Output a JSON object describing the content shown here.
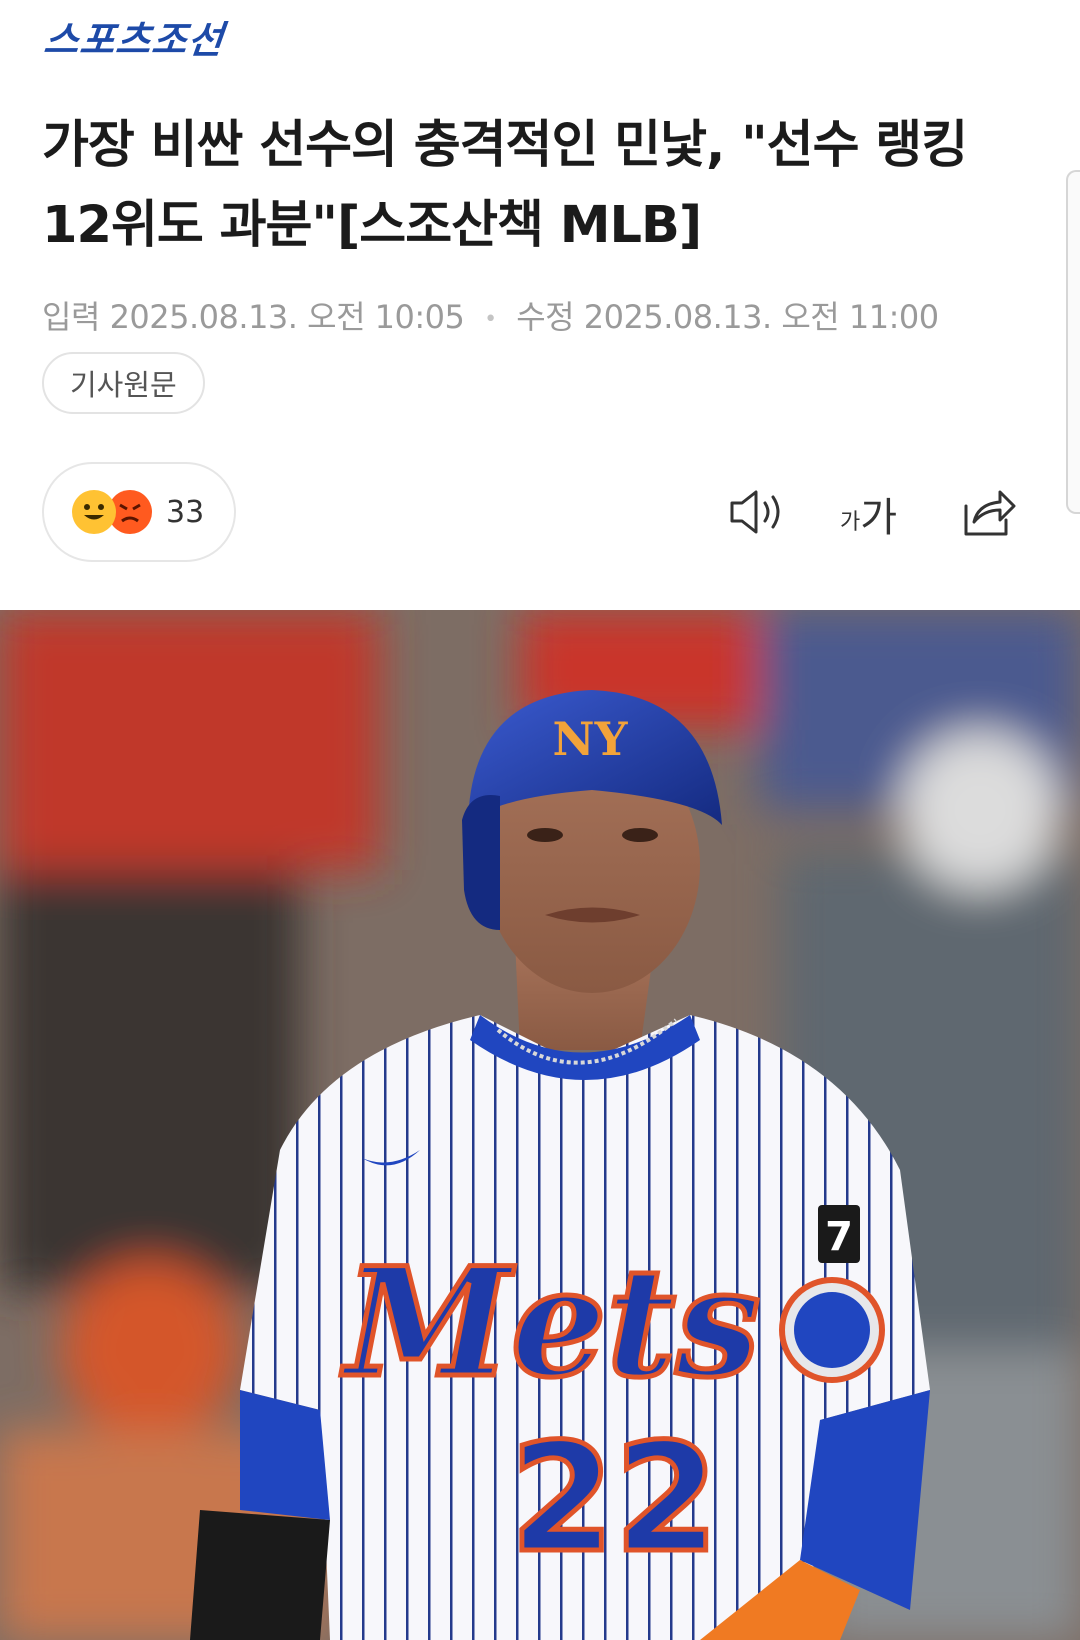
{
  "header": {
    "logo_text": "스포츠조선",
    "brand_color": "#1d4aa8"
  },
  "article": {
    "title": "가장 비싼 선수의 충격적인 민낯, \"선수 랭킹 12위도 과분\"[스조산책 MLB]",
    "input_label": "입력",
    "input_time": "2025.08.13. 오전 10:05",
    "modified_label": "수정",
    "modified_time": "2025.08.13. 오전 11:00",
    "original_button": "기사원문"
  },
  "reactions": {
    "icons": [
      "smile-emoji-icon",
      "angry-emoji-icon"
    ],
    "count": "33"
  },
  "tools": {
    "speaker_icon": "speaker-icon",
    "font_size_label_small": "가",
    "font_size_label_large": "가",
    "share_icon": "share-icon"
  },
  "photo": {
    "jersey_text": "Mets",
    "jersey_number": "22",
    "sleeve_patch_number": "7",
    "helmet_logo": "NY"
  }
}
